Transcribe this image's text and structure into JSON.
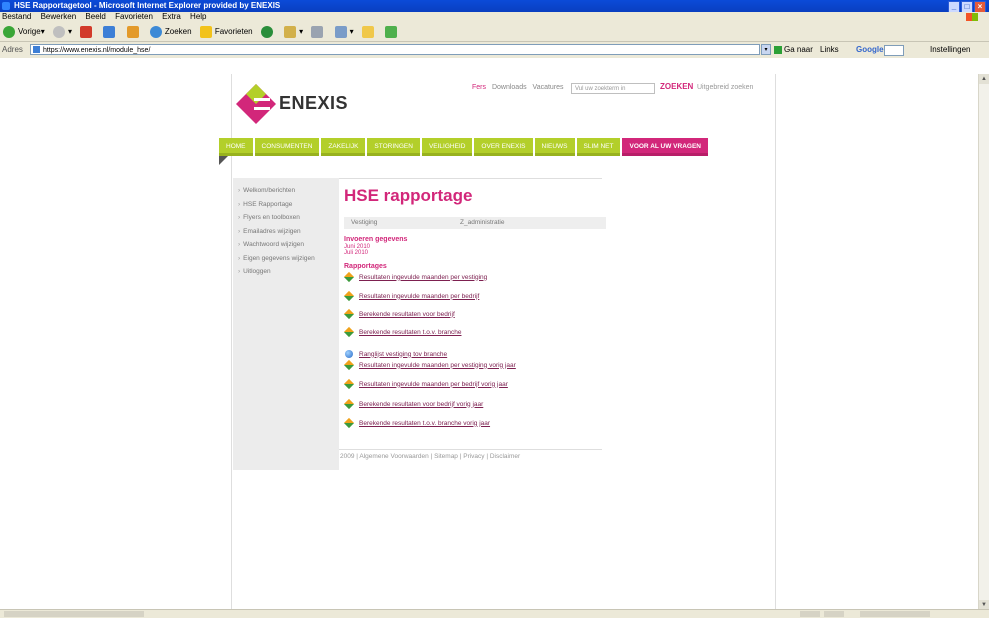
{
  "window": {
    "title": "HSE Rapportagetool - Microsoft Internet Explorer provided by ENEXIS"
  },
  "menubar": [
    "Bestand",
    "Bewerken",
    "Beeld",
    "Favorieten",
    "Extra",
    "Help"
  ],
  "toolbar": {
    "back_label": "Vorige",
    "search_label": "Zoeken",
    "favorites_label": "Favorieten"
  },
  "addressbar": {
    "label": "Adres",
    "url": "https://www.enexis.nl/module_hse/",
    "go_label": "Ga naar",
    "links_label": "Links",
    "google_label": "Google",
    "settings_label": "Instellingen"
  },
  "site": {
    "logo_text": "ENEXIS",
    "toplinks": {
      "fers": "Fers",
      "downloads": "Downloads",
      "vacatures": "Vacatures"
    },
    "search_placeholder": "Vul uw zoekterm in",
    "search_button": "ZOEKEN",
    "advanced_search": "Uitgebreid zoeken",
    "nav": [
      "HOME",
      "CONSUMENTEN",
      "ZAKELIJK",
      "STORINGEN",
      "VEILIGHEID",
      "OVER ENEXIS",
      "NIEUWS",
      "SLIM NET",
      "VOOR AL UW VRAGEN"
    ],
    "sidebar": [
      "Welkom/berichten",
      "HSE Rapportage",
      "Flyers en toolboxen",
      "Emailadres wijzigen",
      "Wachtwoord wijzigen",
      "Eigen gegevens wijzigen",
      "Uitloggen"
    ],
    "page_title": "HSE rapportage",
    "vestiging_label": "Vestiging",
    "vestiging_value": "Z_administratie",
    "invoer_heading": "Invoeren gegevens",
    "months": [
      "Juni 2010",
      "Juli 2010"
    ],
    "rapportages_heading": "Rapportages",
    "reports": [
      "Resultaten ingevulde maanden per vestiging",
      "Resultaten ingevulde maanden per bedrijf",
      "Berekende resultaten voor bedrijf",
      "Berekende resultaten t.o.v. branche",
      "Ranglijst vestiging tov branche",
      "Resultaten ingevulde maanden per vestiging vorig jaar",
      "Resultaten ingevulde maanden per bedrijf vorig jaar",
      "Berekende resultaten voor bedrijf vorig jaar",
      "Berekende resultaten t.o.v. branche vorig jaar"
    ],
    "footer": "2009 | Algemene Voorwaarden | Sitemap | Privacy | Disclaimer"
  },
  "colors": {
    "brand_pink": "#d2277a",
    "nav_green": "#b3cf2a"
  }
}
